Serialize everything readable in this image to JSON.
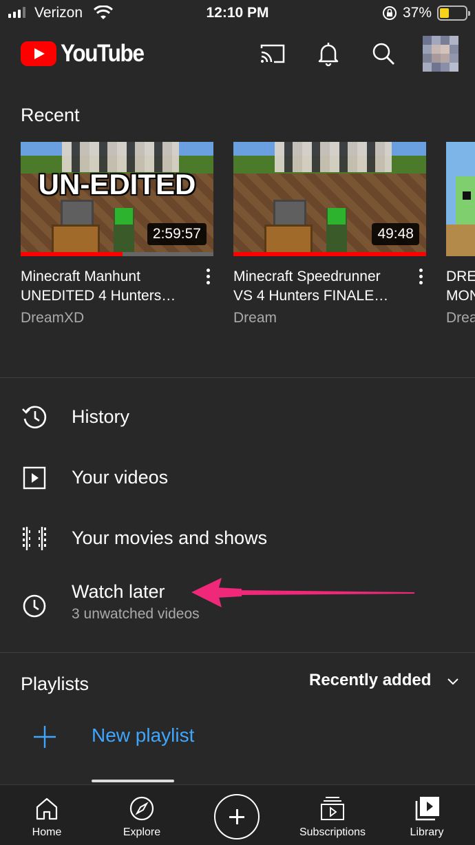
{
  "status_bar": {
    "carrier": "Verizon",
    "time": "12:10 PM",
    "battery_percent": "37%",
    "battery_level": 0.37
  },
  "header": {
    "brand": "YouTube",
    "icons": [
      "cast-icon",
      "notifications-icon",
      "search-icon",
      "avatar"
    ]
  },
  "recent": {
    "title": "Recent",
    "videos": [
      {
        "overlay_text": "UN-EDITED",
        "duration": "2:59:57",
        "title": "Minecraft Manhunt\nUNEDITED 4 Hunters…",
        "channel": "DreamXD",
        "watched_fraction": 0.53
      },
      {
        "overlay_text": "",
        "duration": "49:48",
        "title": "Minecraft Speedrunner\nVS 4 Hunters FINALE…",
        "channel": "Dream",
        "watched_fraction": 1.0
      },
      {
        "overlay_text": "",
        "duration": "",
        "title": "DRE\nMON",
        "channel": "Drea",
        "watched_fraction": 0
      }
    ]
  },
  "library_items": [
    {
      "label": "History",
      "icon": "history-icon",
      "sublabel": ""
    },
    {
      "label": "Your videos",
      "icon": "play-square-icon",
      "sublabel": ""
    },
    {
      "label": "Your movies and shows",
      "icon": "film-strip-icon",
      "sublabel": ""
    },
    {
      "label": "Watch later",
      "icon": "clock-icon",
      "sublabel": "3 unwatched videos"
    }
  ],
  "playlists": {
    "title": "Playlists",
    "sort_label": "Recently added",
    "new_playlist_label": "New playlist"
  },
  "bottom_nav": [
    {
      "label": "Home",
      "icon": "home-icon"
    },
    {
      "label": "Explore",
      "icon": "compass-icon"
    },
    {
      "label": "",
      "icon": "create-plus-icon"
    },
    {
      "label": "Subscriptions",
      "icon": "subscriptions-icon"
    },
    {
      "label": "Library",
      "icon": "library-icon"
    }
  ],
  "colors": {
    "background": "#282828",
    "accent_red": "#ff0000",
    "link_blue": "#3ea6ff",
    "annotation_arrow": "#f0287a",
    "secondary_text": "#aaaaaa"
  }
}
